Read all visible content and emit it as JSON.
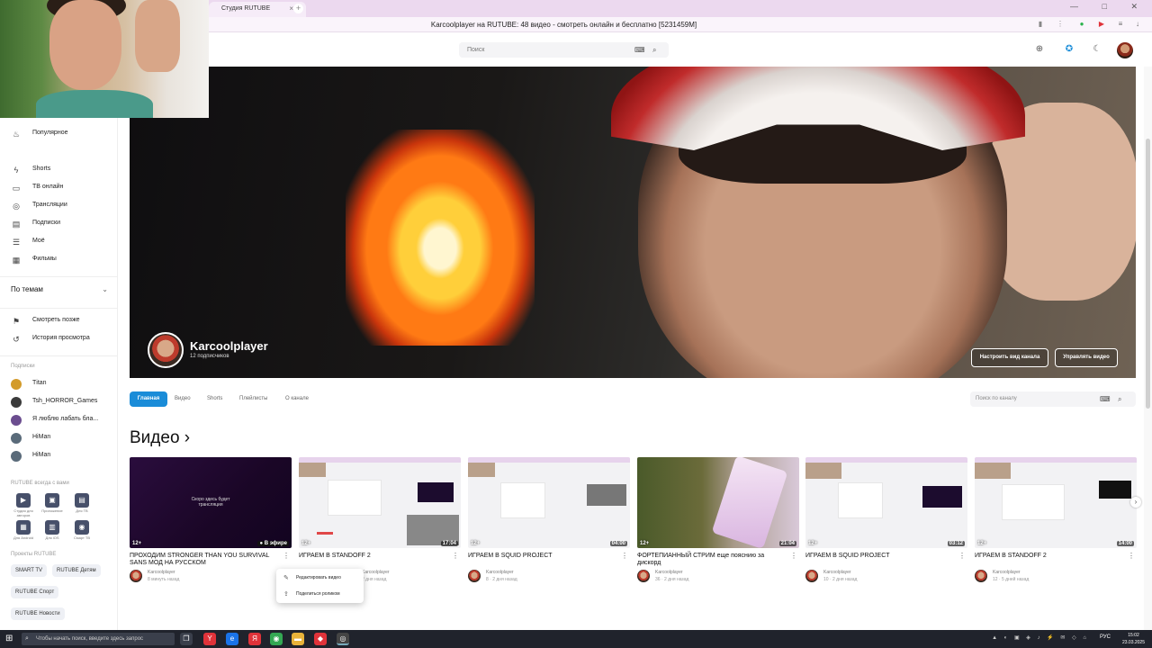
{
  "browser": {
    "tab_title": "Студия RUTUBE",
    "tab_close": "×",
    "new_tab": "+",
    "page_title": "Karcoolplayer на RUTUBE: 48 видео - смотреть онлайн и бесплатно [5231459M]",
    "window_controls": "— □ ✕"
  },
  "header": {
    "search_placeholder": "Поиск"
  },
  "sidebar": {
    "nav": [
      {
        "label": "Популярное",
        "icon": "fire-icon"
      },
      {
        "label": "Shorts",
        "icon": "shorts-icon"
      },
      {
        "label": "ТВ онлайн",
        "icon": "tv-icon"
      },
      {
        "label": "Трансляции",
        "icon": "broadcast-icon"
      },
      {
        "label": "Подписки",
        "icon": "subscriptions-icon"
      },
      {
        "label": "Моё",
        "icon": "my-icon"
      },
      {
        "label": "Фильмы",
        "icon": "film-icon"
      }
    ],
    "topics_label": "По темам",
    "library": [
      {
        "label": "Смотреть позже"
      },
      {
        "label": "История просмотра"
      }
    ],
    "subs_heading": "Подписки",
    "subscriptions": [
      {
        "label": "Тitan",
        "color": "#d39b2a"
      },
      {
        "label": "Tsh_HORROR_Games",
        "color": "#3b3b3b"
      },
      {
        "label": "Я люблю лабать бла...",
        "color": "#6b4d8f"
      },
      {
        "label": "HiMan",
        "color": "#5a6b7a"
      },
      {
        "label": "HiMan",
        "color": "#5a6b7a"
      }
    ],
    "studio_heading": "RUTUBE всегда с вами",
    "apps": [
      {
        "label": "Студия для авторов",
        "glyph": "▶"
      },
      {
        "label": "Приложение",
        "glyph": "▣"
      },
      {
        "label": "Для ТВ",
        "glyph": "▤"
      },
      {
        "label": "Для Android",
        "glyph": "▦"
      },
      {
        "label": "Для iOS",
        "glyph": "▥"
      },
      {
        "label": "Смарт ТВ",
        "glyph": "◉"
      }
    ],
    "projects_heading": "Проекты RUTUBE",
    "projects": [
      "SMART TV",
      "RUTUBE Детям",
      "RUTUBE Спорт",
      "RUTUBE Новости"
    ]
  },
  "channel": {
    "name": "Karcoolplayer",
    "subscribers": "12 подписчиков",
    "btn_customize": "Настроить вид канала",
    "btn_manage": "Управлять видео",
    "tabs": [
      "Главная",
      "Видео",
      "Shorts",
      "Плейлисты",
      "О канале"
    ],
    "search_placeholder": "Поиск по каналу"
  },
  "section_title": "Видео",
  "section_arrow": "›",
  "videos": [
    {
      "title": "ПРОХОДИМ STRONGER THAN YOU SURVIVAL SANS МОД НА РУССКОМ",
      "age": "12+",
      "badge": "● В эфире",
      "channel": "Karcoolplayer",
      "stats": "8 минуть назад",
      "thumb_text": "Скоро здесь будет трансляция"
    },
    {
      "title": "ИГРАЕМ В STANDOFF 2",
      "age": "12+",
      "badge": "17:04",
      "channel": "Karcoolplayer",
      "stats": "2 дня назад"
    },
    {
      "title": "ИГРАЕМ В SQUID PROJECT",
      "age": "12+",
      "badge": "04:00",
      "channel": "Karcoolplayer",
      "stats": "8 · 2 дня назад"
    },
    {
      "title": "ФОРТЕПИАННЫЙ СТРИМ еще пояснию за дискорд",
      "age": "12+",
      "badge": "21:04",
      "channel": "Karcoolplayer",
      "stats": "36 · 2 дня назад"
    },
    {
      "title": "ИГРАЕМ В SQUID PROJECT",
      "age": "12+",
      "badge": "03:12",
      "channel": "Karcoolplayer",
      "stats": "10 · 2 дня назад"
    },
    {
      "title": "ИГРАЕМ В STANDOFF 2",
      "age": "12+",
      "badge": "14:00",
      "channel": "Karcoolplayer",
      "stats": "12 · 5 дней назад"
    }
  ],
  "popup": {
    "edit": "Редактировать видео",
    "share": "Поделиться роликом"
  },
  "taskbar": {
    "search_text": "Чтобы начать поиск, введите здесь запрос",
    "lang": "РУС",
    "time": "15:02",
    "date": "23.03.2025"
  },
  "colors": {
    "accent": "#1a8cd8",
    "tabbar": "#ecd9ef",
    "taskbar": "#20232c"
  }
}
